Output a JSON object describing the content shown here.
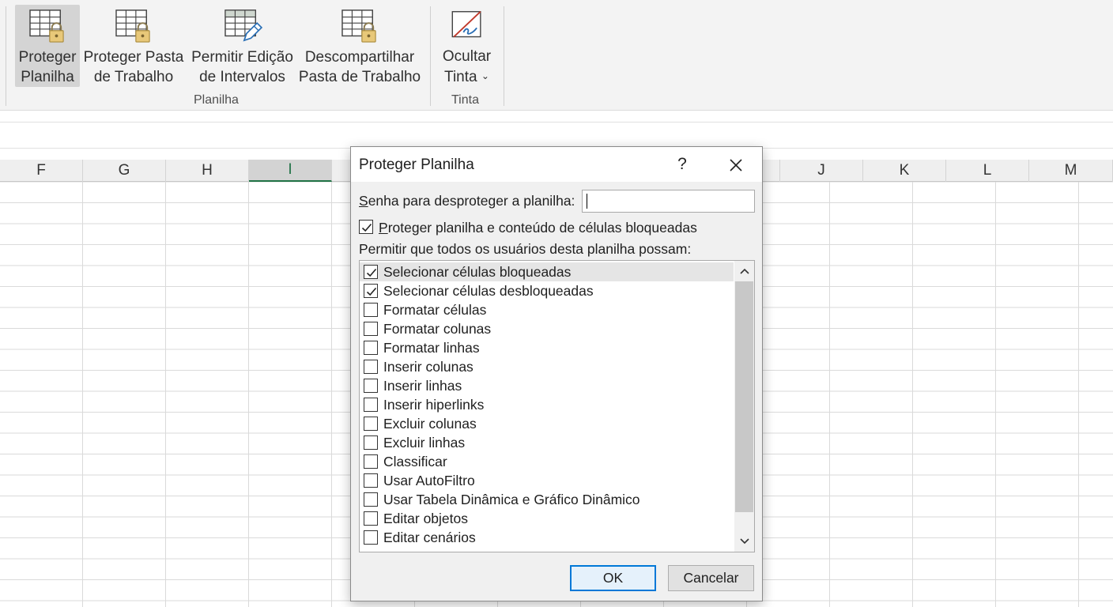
{
  "ribbon": {
    "buttons": {
      "protect_sheet": {
        "line1": "Proteger",
        "line2": "Planilha"
      },
      "protect_workbook": {
        "line1": "Proteger Pasta",
        "line2": "de Trabalho"
      },
      "allow_edit_ranges": {
        "line1": "Permitir Edição",
        "line2": "de Intervalos"
      },
      "unshare_workbook": {
        "line1": "Descompartilhar",
        "line2": "Pasta de Trabalho"
      },
      "hide_ink": {
        "line1": "Ocultar",
        "line2": "Tinta",
        "caret": "⌄"
      }
    },
    "groups": {
      "sheet": "Planilha",
      "ink": "Tinta"
    }
  },
  "columns": [
    "F",
    "G",
    "H",
    "I",
    "",
    "",
    "J",
    "K",
    "L",
    "M"
  ],
  "active_column": "I",
  "dialog": {
    "title": "Proteger Planilha",
    "help": "?",
    "password": {
      "label_accel": "S",
      "label_rest": "enha para desproteger a planilha:",
      "value": ""
    },
    "protect_checkbox": {
      "checked": true,
      "label_accel": "P",
      "label_rest": "roteger planilha e conteúdo de células bloqueadas"
    },
    "allow_label": "Permitir que todos os usuários desta planilha possam:",
    "options": [
      {
        "label": "Selecionar células bloqueadas",
        "checked": true
      },
      {
        "label": "Selecionar células desbloqueadas",
        "checked": true
      },
      {
        "label": "Formatar células",
        "checked": false
      },
      {
        "label": "Formatar colunas",
        "checked": false
      },
      {
        "label": "Formatar linhas",
        "checked": false
      },
      {
        "label": "Inserir colunas",
        "checked": false
      },
      {
        "label": "Inserir linhas",
        "checked": false
      },
      {
        "label": "Inserir hiperlinks",
        "checked": false
      },
      {
        "label": "Excluir colunas",
        "checked": false
      },
      {
        "label": "Excluir linhas",
        "checked": false
      },
      {
        "label": "Classificar",
        "checked": false
      },
      {
        "label": "Usar AutoFiltro",
        "checked": false
      },
      {
        "label": "Usar Tabela Dinâmica e Gráfico Dinâmico",
        "checked": false
      },
      {
        "label": "Editar objetos",
        "checked": false
      },
      {
        "label": "Editar cenários",
        "checked": false
      }
    ],
    "ok_label": "OK",
    "cancel_label": "Cancelar"
  },
  "colors": {
    "accent": "#0078d7",
    "excel_green": "#217346"
  }
}
